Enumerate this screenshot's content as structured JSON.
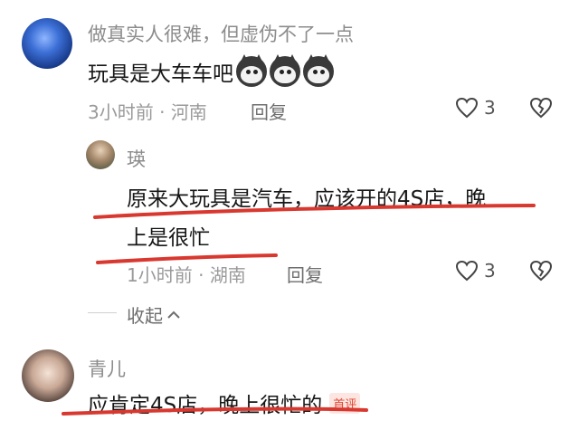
{
  "comments": [
    {
      "username": "做真实人很难，但虚伪不了一点",
      "text": "玩具是大车车吧",
      "emoji_icon": "husky-dog-emoji",
      "time": "3小时前",
      "location": "河南",
      "reply_label": "回复",
      "like_count": "3"
    }
  ],
  "reply": {
    "username": "瑛",
    "text_line1": "原来大玩具是汽车，应该开的4S店，晚",
    "text_line2": "上是很忙",
    "time": "1小时前",
    "location": "湖南",
    "reply_label": "回复",
    "like_count": "3"
  },
  "collapse_label": "收起",
  "third": {
    "username": "青儿",
    "text": "应肯定4S店，晚上很忙的",
    "badge": "首评"
  },
  "colors": {
    "underline": "#d8382f",
    "badge": "#e0442f"
  }
}
